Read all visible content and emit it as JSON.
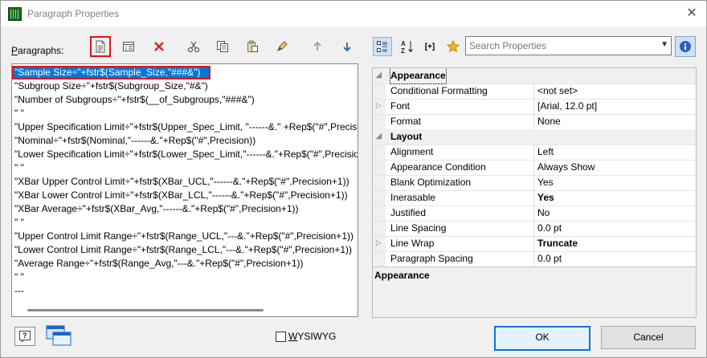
{
  "window": {
    "title": "Paragraph Properties",
    "close_glyph": "✕"
  },
  "left": {
    "paragraphs_label": "Paragraphs:",
    "toolbar": [
      {
        "name": "new-paragraph-icon",
        "highlight": true
      },
      {
        "name": "properties-list-icon"
      },
      {
        "name": "delete-icon"
      },
      {
        "name": "cut-icon"
      },
      {
        "name": "copy-icon"
      },
      {
        "name": "paste-icon"
      },
      {
        "name": "edit-paragraph-icon"
      },
      {
        "name": "move-up-icon"
      },
      {
        "name": "move-down-icon"
      }
    ],
    "items": [
      "\"Sample Size÷\"+fstr$(Sample_Size,\"###&\")",
      "\"Subgroup Size÷\"+fstr$(Subgroup_Size,\"#&\")",
      "\"Number of Subgroups÷\"+fstr$(__of_Subgroups,\"###&\")",
      "\" \"",
      "\"Upper Specification Limit÷\"+fstr$(Upper_Spec_Limit, \"------&.\" +Rep$(\"#\",Precision+1))",
      "\"Nominal÷\"+fstr$(Nominal,\"------&.\"+Rep$(\"#\",Precision))",
      "\"Lower Specification Limit÷\"+fstr$(Lower_Spec_Limit,\"------&.\"+Rep$(\"#\",Precision+1))",
      "\" \"",
      "\"XBar Upper Control Limit÷\"+fstr$(XBar_UCL,\"------&.\"+Rep$(\"#\",Precision+1))",
      "\"XBar Lower Control Limit÷\"+fstr$(XBar_LCL,\"------&.\"+Rep$(\"#\",Precision+1))",
      "\"XBar Average÷\"+fstr$(XBar_Avg,\"------&.\"+Rep$(\"#\",Precision+1))",
      "\" \"",
      "\"Upper Control Limit Range÷\"+fstr$(Range_UCL,\"---&.\"+Rep$(\"#\",Precision+1))",
      "\"Lower Control Limit Range÷\"+fstr$(Range_LCL,\"---&.\"+Rep$(\"#\",Precision+1))",
      "\"Average Range÷\"+fstr$(Range_Avg,\"---&.\"+Rep$(\"#\",Precision+1))",
      "\" \"",
      "---"
    ],
    "selected_index": 0
  },
  "right": {
    "toolbar": [
      {
        "name": "categorized-view-icon",
        "active": true
      },
      {
        "name": "alphabetical-sort-icon"
      },
      {
        "name": "expression-icon",
        "text": "[+]"
      },
      {
        "name": "favorites-star-icon"
      }
    ],
    "search": {
      "placeholder": "Search Properties",
      "value": ""
    },
    "grid": {
      "rows": [
        {
          "type": "category",
          "name": "Appearance",
          "expander": "◢"
        },
        {
          "type": "prop",
          "name": "Conditional Formatting",
          "value": "<not set>"
        },
        {
          "type": "prop",
          "name": "Font",
          "value": "[Arial, 12.0 pt]",
          "expander": "▷"
        },
        {
          "type": "prop",
          "name": "Format",
          "value": "None"
        },
        {
          "type": "category",
          "name": "Layout",
          "expander": "◢"
        },
        {
          "type": "prop",
          "name": "Alignment",
          "value": "Left"
        },
        {
          "type": "prop",
          "name": "Appearance Condition",
          "value": "Always Show"
        },
        {
          "type": "prop",
          "name": "Blank Optimization",
          "value": "Yes"
        },
        {
          "type": "prop",
          "name": "Inerasable",
          "value": "Yes",
          "bold": true
        },
        {
          "type": "prop",
          "name": "Justified",
          "value": "No"
        },
        {
          "type": "prop",
          "name": "Line Spacing",
          "value": "0.0 pt"
        },
        {
          "type": "prop",
          "name": "Line Wrap",
          "value": "Truncate",
          "bold": true,
          "expander": "▷"
        },
        {
          "type": "prop",
          "name": "Paragraph Spacing",
          "value": "0.0 pt"
        }
      ],
      "description_title": "Appearance"
    }
  },
  "footer": {
    "wysiwyg_label": "WYSIWYG",
    "wysiwyg_checked": false,
    "ok_label": "OK",
    "cancel_label": "Cancel"
  }
}
